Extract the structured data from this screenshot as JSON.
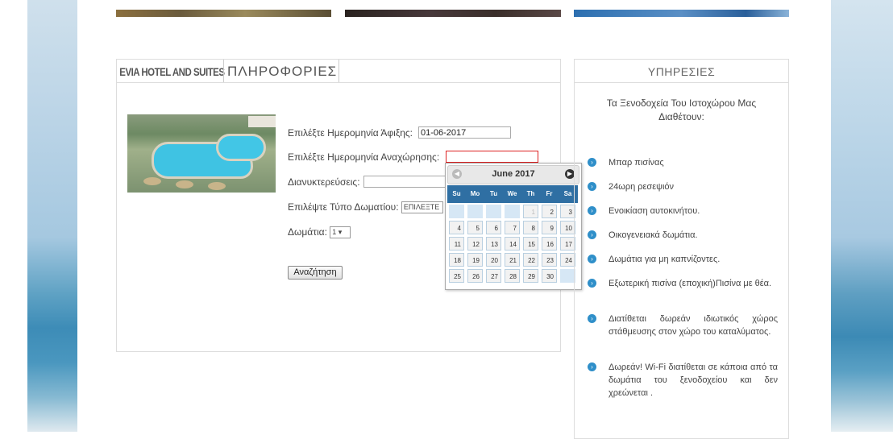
{
  "main": {
    "tab_brand": "EVIA HOTEL AND SUITES",
    "tab_info": "ΠΛΗΡΟΦΟΡΙΕΣ",
    "form": {
      "arrival_label": "Επιλέξτε Ημερομηνία Άφιξης:",
      "arrival_value": "01-06-2017",
      "departure_label": "Επιλέξτε Ημερομηνία Αναχώρησης:",
      "departure_value": "",
      "nights_label": "Διανυκτερεύσεις:",
      "nights_value": "",
      "room_type_label": "Επιλέψτε Τύπο Δωματίου:",
      "room_type_value": "ΕΠΙΛΕΞΤΕ",
      "rooms_label": "Δωμάτια:",
      "rooms_value": "1",
      "search_button": "Αναζήτηση"
    }
  },
  "datepicker": {
    "title": "June 2017",
    "prev_icon": "◀",
    "next_icon": "▶",
    "weekdays": [
      "Su",
      "Mo",
      "Tu",
      "We",
      "Th",
      "Fr",
      "Sa"
    ],
    "weeks": [
      [
        "",
        "",
        "",
        "",
        "1",
        "2",
        "3"
      ],
      [
        "4",
        "5",
        "6",
        "7",
        "8",
        "9",
        "10"
      ],
      [
        "11",
        "12",
        "13",
        "14",
        "15",
        "16",
        "17"
      ],
      [
        "18",
        "19",
        "20",
        "21",
        "22",
        "23",
        "24"
      ],
      [
        "25",
        "26",
        "27",
        "28",
        "29",
        "30",
        ""
      ]
    ]
  },
  "services": {
    "title": "ΥΠΗΡΕΣΙΕΣ",
    "intro": "Τα Ξενοδοχεία Του Ιστοχώρου Μας Διαθέτουν:",
    "items": [
      "Μπαρ πισίνας",
      "24ωρη ρεσεψιόν",
      "Ενοικίαση αυτοκινήτου.",
      "Οικογενειακά δωμάτια.",
      "Δωμάτια για μη καπνίζοντες.",
      "Εξωτερική πισίνα (εποχική)Πισίνα με θέα.",
      "Διατίθεται δωρεάν ιδιωτικός χώρος στάθμευσης στον χώρο του καταλύματος.",
      "Δωρεάν! Wi-Fi διατίθεται σε κάποια από τα δωμάτια του ξενοδοχείου και δεν χρεώνεται ."
    ]
  }
}
